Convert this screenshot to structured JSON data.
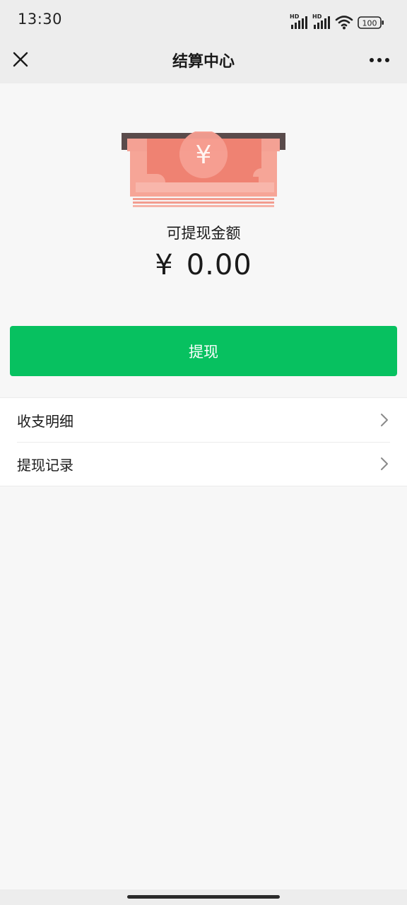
{
  "status_bar": {
    "time": "13:30",
    "signal_1_label": "HD",
    "signal_2_label": "HD",
    "battery": "100"
  },
  "nav": {
    "title": "结算中心",
    "close_icon": "close-icon",
    "more_icon": "more-dots-icon"
  },
  "balance": {
    "label": "可提现金额",
    "currency": "¥",
    "amount": "0.00",
    "illustration_symbol": "¥"
  },
  "withdraw_button": {
    "label": "提现",
    "color": "#07c160"
  },
  "menu": {
    "items": [
      {
        "label": "收支明细",
        "icon": "chevron-right-icon"
      },
      {
        "label": "提现记录",
        "icon": "chevron-right-icon"
      }
    ]
  }
}
